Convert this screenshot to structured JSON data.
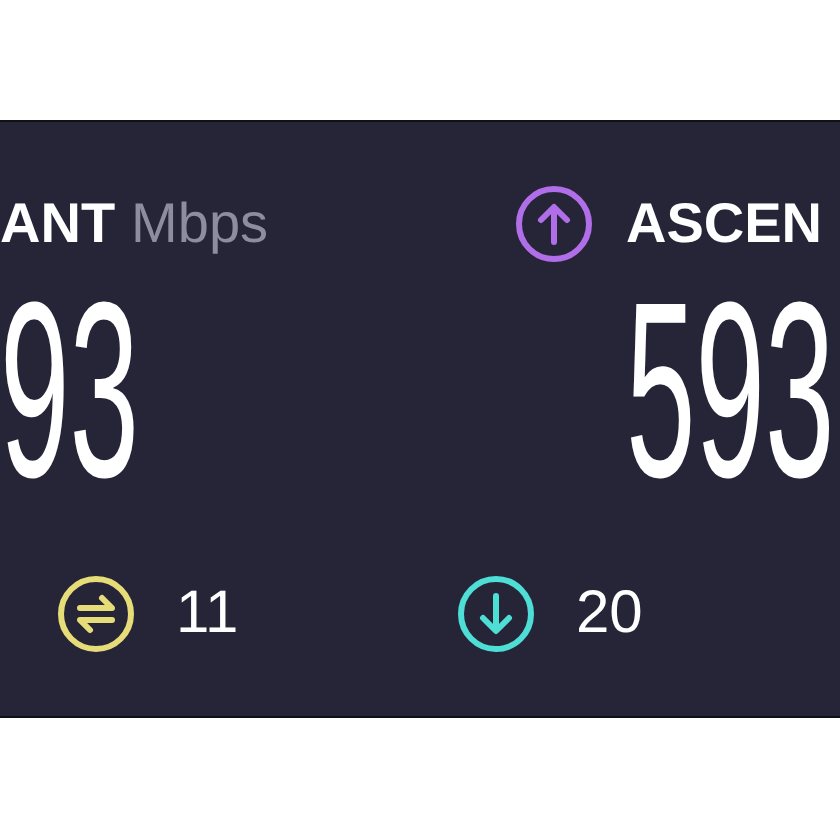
{
  "download": {
    "label": "ANT",
    "unit": "Mbps",
    "value": "93"
  },
  "upload": {
    "label": "ASCEN",
    "value": "593"
  },
  "stats": [
    {
      "kind": "ping",
      "value": "11",
      "color": "#e6dd78"
    },
    {
      "kind": "down",
      "value": "20",
      "color": "#4fded6"
    }
  ]
}
